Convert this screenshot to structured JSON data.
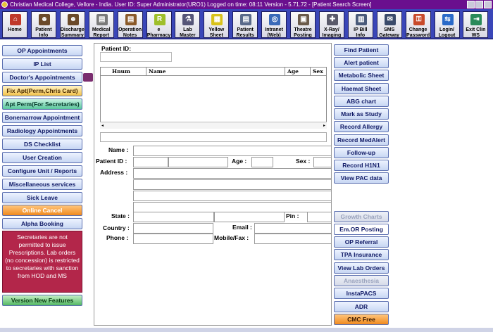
{
  "window": {
    "title": "Christian Medical College, Vellore - India.   User ID: Super Administrator(URO1)   Logged on time: 08:11   Version - 5.71.72 - [Patient Search Screen]"
  },
  "toolbar": [
    {
      "name": "home",
      "label": "Home",
      "icon": "house-icon",
      "color": "#c0392b",
      "glyph": "⌂"
    },
    {
      "name": "patient-info",
      "label": "Patient Info",
      "icon": "person-icon",
      "color": "#6b4a2a",
      "glyph": "☻"
    },
    {
      "name": "discharge-summary",
      "label": "Discharge Summary",
      "icon": "people-icon",
      "color": "#6b4a2a",
      "glyph": "☻"
    },
    {
      "name": "medical-report",
      "label": "Medical Report",
      "icon": "document-icon",
      "color": "#7a7a7a",
      "glyph": "▤"
    },
    {
      "name": "operation-notes",
      "label": "Operation Notes",
      "icon": "document-icon",
      "color": "#8a5a2a",
      "glyph": "▤"
    },
    {
      "name": "e-pharmacy",
      "label": "e Pharmacy",
      "icon": "rx-icon",
      "color": "#9fbf2a",
      "glyph": "R"
    },
    {
      "name": "lab-master",
      "label": "Lab Master",
      "icon": "lab-icon",
      "color": "#555577",
      "glyph": "⚗"
    },
    {
      "name": "yellow-sheet",
      "label": "Yellow Sheet",
      "icon": "sheet-icon",
      "color": "#d8c21a",
      "glyph": "▦"
    },
    {
      "name": "patient-results",
      "label": "Patient Results",
      "icon": "results-icon",
      "color": "#5a6a8a",
      "glyph": "▤"
    },
    {
      "name": "intranet-web",
      "label": "Intranet (Web)",
      "icon": "web-icon",
      "color": "#3a6ab8",
      "glyph": "◎"
    },
    {
      "name": "theatre-posting",
      "label": "Theatre Posting",
      "icon": "theatre-icon",
      "color": "#6a5a4a",
      "glyph": "▣"
    },
    {
      "name": "xray-imaging",
      "label": "X-Ray/ Imaging",
      "icon": "xray-icon",
      "color": "#5a5a6a",
      "glyph": "✚"
    },
    {
      "name": "ip-bill-info",
      "label": "IP Bill Info",
      "icon": "bill-icon",
      "color": "#4a5a7a",
      "glyph": "▥"
    },
    {
      "name": "sms-gateway",
      "label": "SMS Gateway",
      "icon": "sms-icon",
      "color": "#3a4a6a",
      "glyph": "✉"
    },
    {
      "name": "change-password",
      "label": "Change Password",
      "icon": "key-icon",
      "color": "#c84a2a",
      "glyph": "⚿"
    },
    {
      "name": "login-logout",
      "label": "Login/ Logout",
      "icon": "login-icon",
      "color": "#2a6ac8",
      "glyph": "⇆"
    },
    {
      "name": "exit-clin-ws",
      "label": "Exit Clin WS",
      "icon": "exit-icon",
      "color": "#2a8a5a",
      "glyph": "⇥"
    }
  ],
  "left_menu": [
    {
      "name": "op-appointments",
      "label": "OP Appointments",
      "style": ""
    },
    {
      "name": "ip-list",
      "label": "IP List",
      "style": ""
    },
    {
      "name": "doctors-appointments",
      "label": "Doctor's Appointments",
      "style": ""
    },
    {
      "name": "fix-apt",
      "label": "Fix Apt(Perm,Chris Card)",
      "style": "yellow"
    },
    {
      "name": "apt-perm",
      "label": "Apt Perm(For Secretaries)",
      "style": "teal"
    },
    {
      "name": "bonemarrow-appointment",
      "label": "Bonemarrow Appointment",
      "style": ""
    },
    {
      "name": "radiology-appointments",
      "label": "Radiology Appointments",
      "style": ""
    },
    {
      "name": "ds-checklist",
      "label": "DS Checklist",
      "style": ""
    },
    {
      "name": "user-creation",
      "label": "User Creation",
      "style": ""
    },
    {
      "name": "configure-unit-reports",
      "label": "Configure Unit / Reports",
      "style": ""
    },
    {
      "name": "miscellaneous-services",
      "label": "Miscellaneous services",
      "style": ""
    },
    {
      "name": "sick-leave",
      "label": "Sick Leave",
      "style": ""
    },
    {
      "name": "online-cancel",
      "label": "Online Cancel",
      "style": "orange"
    },
    {
      "name": "alpha-booking",
      "label": "Alpha Booking",
      "style": ""
    }
  ],
  "notice": "Secretaries are not permitted to issue Prescriptions. Lab orders (no concession) is restricted to secretaries with sanction from HOD and MS",
  "version_button": "Version New Features",
  "search": {
    "patient_id_label": "Patient ID:",
    "columns": [
      "Hnum",
      "Name",
      "Age",
      "Sex"
    ]
  },
  "form": {
    "name": "Name :",
    "patient_id": "Patient ID :",
    "age": "Age :",
    "sex": "Sex :",
    "address": "Address :",
    "state": "State :",
    "pin": "Pin :",
    "country": "Country :",
    "email": "Email :",
    "phone": "Phone :",
    "mobile_fax": "Mobile/Fax :"
  },
  "right_menu": [
    {
      "name": "find-patient",
      "label": "Find Patient",
      "style": ""
    },
    {
      "name": "alert-patient",
      "label": "Alert  patient",
      "style": ""
    },
    {
      "name": "metabolic-sheet",
      "label": "Metabolic Sheet",
      "style": ""
    },
    {
      "name": "haemat-sheet",
      "label": "Haemat Sheet",
      "style": ""
    },
    {
      "name": "abg-chart",
      "label": "ABG chart",
      "style": ""
    },
    {
      "name": "mark-as-study",
      "label": "Mark as Study",
      "style": ""
    },
    {
      "name": "record-allergy",
      "label": "Record Allergy",
      "style": ""
    },
    {
      "name": "record-medalert",
      "label": "Record MedAlert",
      "style": ""
    },
    {
      "name": "follow-up",
      "label": "Follow-up",
      "style": ""
    },
    {
      "name": "record-h1n1",
      "label": "Record H1N1",
      "style": ""
    },
    {
      "name": "view-pac-data",
      "label": "View PAC data",
      "style": ""
    },
    {
      "name": "growth-charts",
      "label": "Growth Charts",
      "style": "disabled"
    },
    {
      "name": "em-or-posting",
      "label": "Em.OR Posting",
      "style": "white"
    },
    {
      "name": "op-referral",
      "label": "OP Referral",
      "style": ""
    },
    {
      "name": "tpa-insurance",
      "label": "TPA Insurance",
      "style": ""
    },
    {
      "name": "view-lab-orders",
      "label": "View Lab Orders",
      "style": ""
    },
    {
      "name": "anaesthesia",
      "label": "Anaesthesia",
      "style": "disabled"
    },
    {
      "name": "instapacs",
      "label": "InstaPACS",
      "style": ""
    },
    {
      "name": "adr",
      "label": "ADR",
      "style": ""
    },
    {
      "name": "cmc-free",
      "label": "CMC Free",
      "style": "orange"
    }
  ]
}
